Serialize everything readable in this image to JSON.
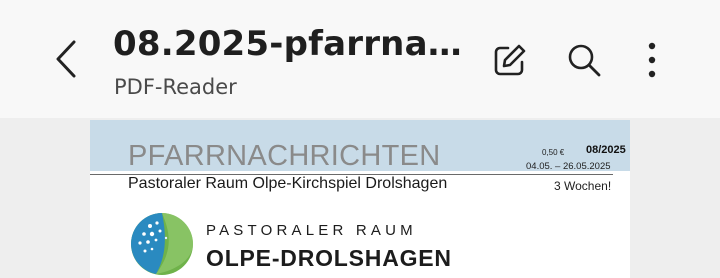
{
  "header": {
    "title": "08.2025-pfarrnachr...",
    "subtitle": "PDF-Reader",
    "back_icon": "back-arrow-icon",
    "actions": [
      {
        "icon": "edit-icon"
      },
      {
        "icon": "search-icon"
      },
      {
        "icon": "more-vertical-icon"
      }
    ]
  },
  "document": {
    "title": "PFARRNACHRICHTEN",
    "subtitle": "Pastoraler Raum Olpe-Kirchspiel Drolshagen",
    "price": "0,50 €",
    "issue": "08/2025",
    "date_range": "04.05. – 26.05.2025",
    "duration": "3 Wochen!",
    "logo_line1": "PASTORALER RAUM",
    "logo_line2": "OLPE-DROLSHAGEN"
  },
  "colors": {
    "band": "#c8dbe8",
    "logo_blue": "#2a8ac0",
    "logo_green": "#6fb24a"
  }
}
